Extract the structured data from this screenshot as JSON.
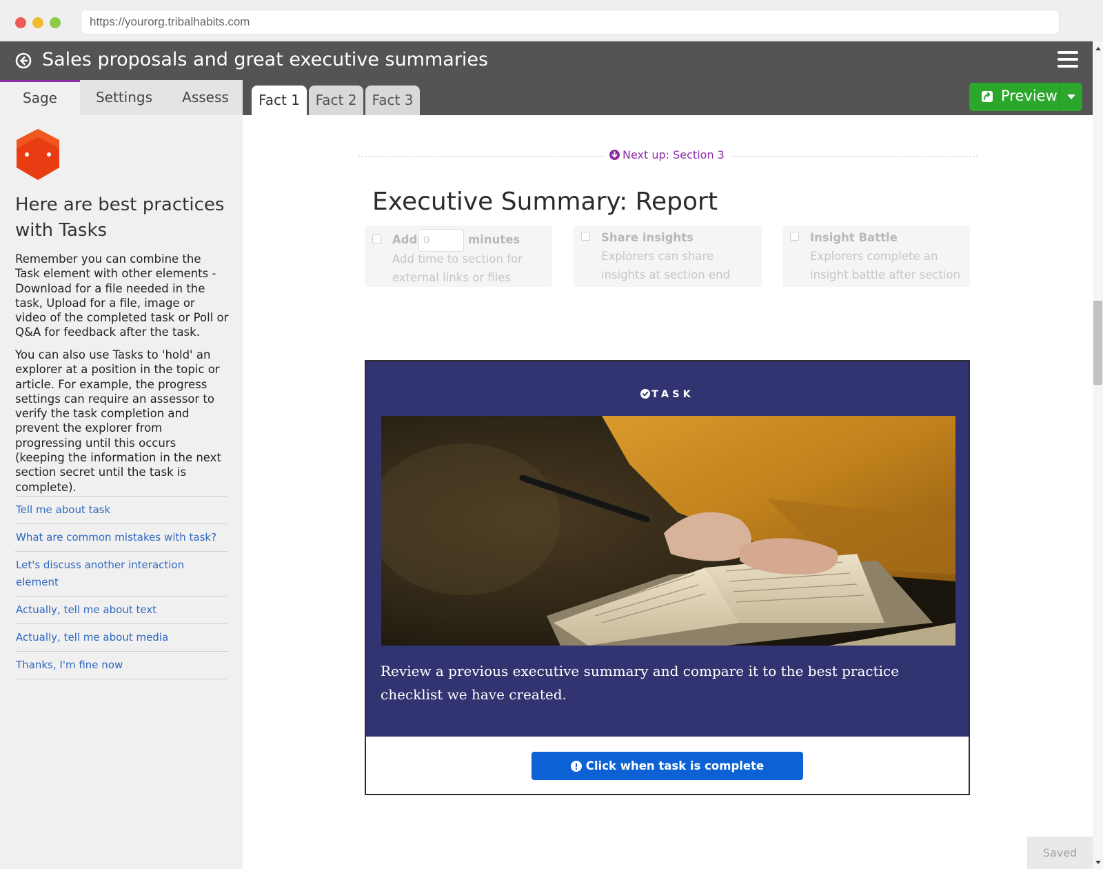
{
  "browser": {
    "url": "https://yourorg.tribalhabits.com"
  },
  "header": {
    "title": "Sales proposals and great executive summaries"
  },
  "left_tabs": [
    {
      "label": "Sage",
      "active": true
    },
    {
      "label": "Settings",
      "active": false
    },
    {
      "label": "Assess",
      "active": false
    }
  ],
  "fact_tabs": [
    {
      "label": "Fact 1",
      "active": true
    },
    {
      "label": "Fact 2",
      "active": false
    },
    {
      "label": "Fact 3",
      "active": false
    }
  ],
  "preview": {
    "label": "Preview"
  },
  "sage": {
    "heading": "Here are best practices with Tasks",
    "paragraph1": "Remember you can combine the Task element with other elements - Download for a file needed in the task, Upload for a file, image or video of the completed task or Poll or Q&A for feedback after the task.",
    "paragraph2": "You can also use Tasks to 'hold' an explorer at a position in the topic or article. For example, the progress settings can require an assessor to verify the task completion and prevent the explorer from progressing until this occurs (keeping the information in the next section secret until the task is complete).",
    "links": [
      "Tell me about task",
      "What are common mistakes with task?",
      "Let's discuss another interaction element",
      "Actually, tell me about text",
      "Actually, tell me about media",
      "Thanks, I'm fine now"
    ]
  },
  "section": {
    "next_up": "Next up: Section 3",
    "title": "Executive Summary: Report"
  },
  "options": {
    "add": {
      "label": "Add",
      "value": "0",
      "unit": "minutes",
      "description": "Add time to section for external links or files"
    },
    "share": {
      "label": "Share insights",
      "description": "Explorers can share insights at section end"
    },
    "battle": {
      "label": "Insight Battle",
      "description": "Explorers complete an insight battle after section"
    }
  },
  "task": {
    "label": "TASK",
    "text": "Review a previous executive summary and compare it to the best practice checklist we have created.",
    "button": "Click when task is complete"
  },
  "status": {
    "saved": "Saved"
  },
  "colors": {
    "header_bg": "#545454",
    "accent_purple": "#8a2ba8",
    "preview_green": "#2da62c",
    "task_bg": "#323371",
    "button_blue": "#0c62d5",
    "link_blue": "#2e67c0",
    "sage_orange": "#ea3c12"
  }
}
